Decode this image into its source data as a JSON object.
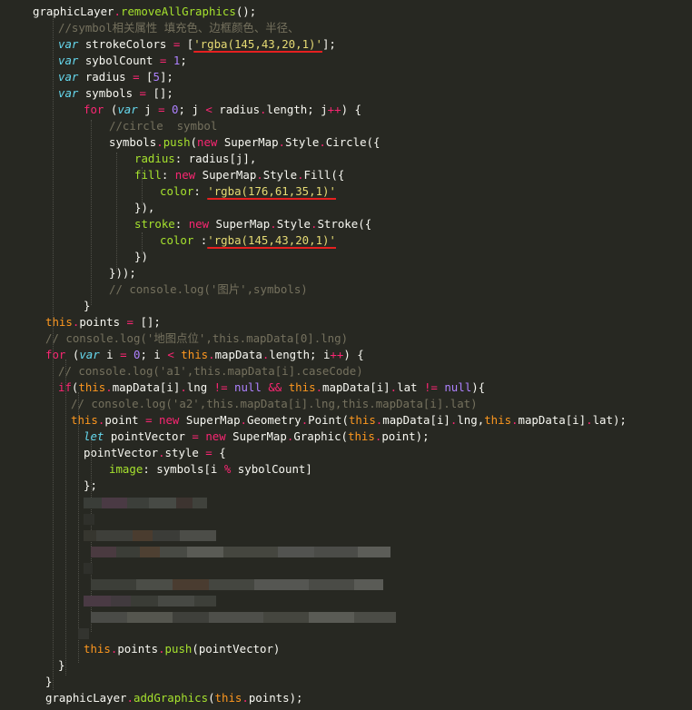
{
  "editor": {
    "theme": "monokai",
    "colors": {
      "background": "#272822",
      "plain": "#f8f8f2",
      "keyword": "#f92672",
      "string": "#e6db74",
      "number": "#ae81ff",
      "function": "#a6e22e",
      "storage": "#66d9ef",
      "comment": "#75715e",
      "builtin": "#fd971f",
      "underline": "#e62020"
    },
    "lines": [
      {
        "tokens": [
          [
            "graphicLayer",
            "pl"
          ],
          [
            ".",
            "kw"
          ],
          [
            "removeAllGraphics",
            "fn"
          ],
          [
            "();",
            "pl"
          ]
        ]
      },
      {
        "tokens": [
          [
            "//symbol相关属性 填充色、边框颜色、半径、",
            "cm"
          ]
        ]
      },
      {
        "tokens": [
          [
            "var",
            "it"
          ],
          [
            " strokeColors ",
            "pl"
          ],
          [
            "=",
            "kw"
          ],
          [
            " [",
            "pl"
          ],
          [
            "'rgba(145,43,20,1)'",
            "st-ul"
          ],
          [
            "];",
            "pl"
          ]
        ]
      },
      {
        "tokens": [
          [
            "var",
            "it"
          ],
          [
            " sybolCount ",
            "pl"
          ],
          [
            "=",
            "kw"
          ],
          [
            " ",
            "pl"
          ],
          [
            "1",
            "nu"
          ],
          [
            ";",
            "pl"
          ]
        ]
      },
      {
        "tokens": [
          [
            "var",
            "it"
          ],
          [
            " radius ",
            "pl"
          ],
          [
            "=",
            "kw"
          ],
          [
            " [",
            "pl"
          ],
          [
            "5",
            "nu"
          ],
          [
            "];",
            "pl"
          ]
        ]
      },
      {
        "tokens": [
          [
            "var",
            "it"
          ],
          [
            " symbols ",
            "pl"
          ],
          [
            "=",
            "kw"
          ],
          [
            " [];",
            "pl"
          ]
        ]
      },
      {
        "tokens": [
          [
            "for",
            "kw"
          ],
          [
            " (",
            "pl"
          ],
          [
            "var",
            "it"
          ],
          [
            " j ",
            "pl"
          ],
          [
            "=",
            "kw"
          ],
          [
            " ",
            "pl"
          ],
          [
            "0",
            "nu"
          ],
          [
            "; j ",
            "pl"
          ],
          [
            "<",
            "kw"
          ],
          [
            " radius",
            "pl"
          ],
          [
            ".",
            "kw"
          ],
          [
            "length; j",
            "pl"
          ],
          [
            "++",
            "kw"
          ],
          [
            ") {",
            "pl"
          ]
        ]
      },
      {
        "tokens": [
          [
            "//circle  symbol",
            "cm"
          ]
        ]
      },
      {
        "tokens": [
          [
            "symbols",
            "pl"
          ],
          [
            ".",
            "kw"
          ],
          [
            "push",
            "fn"
          ],
          [
            "(",
            "pl"
          ],
          [
            "new",
            "kw"
          ],
          [
            " SuperMap",
            "pl"
          ],
          [
            ".",
            "kw"
          ],
          [
            "Style",
            "pl"
          ],
          [
            ".",
            "kw"
          ],
          [
            "Circle",
            "pl"
          ],
          [
            "({",
            "pl"
          ]
        ]
      },
      {
        "tokens": [
          [
            "radius",
            "fn"
          ],
          [
            ": radius[j],",
            "pl"
          ]
        ]
      },
      {
        "tokens": [
          [
            "fill",
            "fn"
          ],
          [
            ": ",
            "pl"
          ],
          [
            "new",
            "kw"
          ],
          [
            " SuperMap",
            "pl"
          ],
          [
            ".",
            "kw"
          ],
          [
            "Style",
            "pl"
          ],
          [
            ".",
            "kw"
          ],
          [
            "Fill",
            "pl"
          ],
          [
            "({",
            "pl"
          ]
        ]
      },
      {
        "tokens": [
          [
            "color",
            "fn"
          ],
          [
            ": ",
            "pl"
          ],
          [
            "'rgba(176,61,35,1)'",
            "st-ul"
          ]
        ]
      },
      {
        "tokens": [
          [
            "}),",
            "pl"
          ]
        ]
      },
      {
        "tokens": [
          [
            "stroke",
            "fn"
          ],
          [
            ": ",
            "pl"
          ],
          [
            "new",
            "kw"
          ],
          [
            " SuperMap",
            "pl"
          ],
          [
            ".",
            "kw"
          ],
          [
            "Style",
            "pl"
          ],
          [
            ".",
            "kw"
          ],
          [
            "Stroke",
            "pl"
          ],
          [
            "({",
            "pl"
          ]
        ]
      },
      {
        "tokens": [
          [
            "color ",
            "fn"
          ],
          [
            ":",
            "pl"
          ],
          [
            "'rgba(145,43,20,1)'",
            "st-ul"
          ]
        ]
      },
      {
        "tokens": [
          [
            "})",
            "pl"
          ]
        ]
      },
      {
        "tokens": [
          [
            "}));",
            "pl"
          ]
        ]
      },
      {
        "tokens": [
          [
            "// console.log('图片',symbols)",
            "cm"
          ]
        ]
      },
      {
        "tokens": [
          [
            "}",
            "pl"
          ]
        ]
      },
      {
        "tokens": [
          [
            "this",
            "bi"
          ],
          [
            ".",
            "kw"
          ],
          [
            "points ",
            "pl"
          ],
          [
            "=",
            "kw"
          ],
          [
            " [];",
            "pl"
          ]
        ]
      },
      {
        "tokens": [
          [
            "// console.log('地图点位',this.mapData[0].lng)",
            "cm"
          ]
        ]
      },
      {
        "tokens": [
          [
            "for",
            "kw"
          ],
          [
            " (",
            "pl"
          ],
          [
            "var",
            "it"
          ],
          [
            " i ",
            "pl"
          ],
          [
            "=",
            "kw"
          ],
          [
            " ",
            "pl"
          ],
          [
            "0",
            "nu"
          ],
          [
            "; i ",
            "pl"
          ],
          [
            "<",
            "kw"
          ],
          [
            " ",
            "pl"
          ],
          [
            "this",
            "bi"
          ],
          [
            ".",
            "kw"
          ],
          [
            "mapData",
            "pl"
          ],
          [
            ".",
            "kw"
          ],
          [
            "length; i",
            "pl"
          ],
          [
            "++",
            "kw"
          ],
          [
            ") {",
            "pl"
          ]
        ]
      },
      {
        "tokens": [
          [
            "// console.log('a1',this.mapData[i].caseCode)",
            "cm"
          ]
        ]
      },
      {
        "tokens": [
          [
            "if",
            "kw"
          ],
          [
            "(",
            "pl"
          ],
          [
            "this",
            "bi"
          ],
          [
            ".",
            "kw"
          ],
          [
            "mapData[i]",
            "pl"
          ],
          [
            ".",
            "kw"
          ],
          [
            "lng ",
            "pl"
          ],
          [
            "!=",
            "kw"
          ],
          [
            " ",
            "pl"
          ],
          [
            "null",
            "nu"
          ],
          [
            " ",
            "pl"
          ],
          [
            "&&",
            "kw"
          ],
          [
            " ",
            "pl"
          ],
          [
            "this",
            "bi"
          ],
          [
            ".",
            "kw"
          ],
          [
            "mapData[i]",
            "pl"
          ],
          [
            ".",
            "kw"
          ],
          [
            "lat ",
            "pl"
          ],
          [
            "!=",
            "kw"
          ],
          [
            " ",
            "pl"
          ],
          [
            "null",
            "nu"
          ],
          [
            "){",
            "pl"
          ]
        ]
      },
      {
        "tokens": [
          [
            "// console.log('a2',this.mapData[i].lng,this.mapData[i].lat)",
            "cm"
          ]
        ]
      },
      {
        "tokens": [
          [
            "this",
            "bi"
          ],
          [
            ".",
            "kw"
          ],
          [
            "point ",
            "pl"
          ],
          [
            "=",
            "kw"
          ],
          [
            " ",
            "pl"
          ],
          [
            "new",
            "kw"
          ],
          [
            " SuperMap",
            "pl"
          ],
          [
            ".",
            "kw"
          ],
          [
            "Geometry",
            "pl"
          ],
          [
            ".",
            "kw"
          ],
          [
            "Point",
            "pl"
          ],
          [
            "(",
            "pl"
          ],
          [
            "this",
            "bi"
          ],
          [
            ".",
            "kw"
          ],
          [
            "mapData[i]",
            "pl"
          ],
          [
            ".",
            "kw"
          ],
          [
            "lng,",
            "pl"
          ],
          [
            "this",
            "bi"
          ],
          [
            ".",
            "kw"
          ],
          [
            "mapData[i]",
            "pl"
          ],
          [
            ".",
            "kw"
          ],
          [
            "lat);",
            "pl"
          ]
        ]
      },
      {
        "tokens": [
          [
            "let",
            "it"
          ],
          [
            " pointVector ",
            "pl"
          ],
          [
            "=",
            "kw"
          ],
          [
            " ",
            "pl"
          ],
          [
            "new",
            "kw"
          ],
          [
            " SuperMap",
            "pl"
          ],
          [
            ".",
            "kw"
          ],
          [
            "Graphic",
            "pl"
          ],
          [
            "(",
            "pl"
          ],
          [
            "this",
            "bi"
          ],
          [
            ".",
            "kw"
          ],
          [
            "point);",
            "pl"
          ]
        ]
      },
      {
        "tokens": [
          [
            "pointVector",
            "pl"
          ],
          [
            ".",
            "kw"
          ],
          [
            "style ",
            "pl"
          ],
          [
            "=",
            "kw"
          ],
          [
            " {",
            "pl"
          ]
        ]
      },
      {
        "tokens": [
          [
            "image",
            "fn"
          ],
          [
            ": symbols[i ",
            "pl"
          ],
          [
            "%",
            "kw"
          ],
          [
            " sybolCount]",
            "pl"
          ]
        ]
      },
      {
        "tokens": [
          [
            "};",
            "pl"
          ]
        ]
      },
      {
        "tokens": [
          [
            "this",
            "bi"
          ],
          [
            ".",
            "kw"
          ],
          [
            "points",
            "pl"
          ],
          [
            ".",
            "kw"
          ],
          [
            "push",
            "fn"
          ],
          [
            "(pointVector)",
            "pl"
          ]
        ]
      },
      {
        "tokens": [
          [
            "}",
            "pl"
          ]
        ]
      },
      {
        "tokens": [
          [
            "}",
            "pl"
          ]
        ]
      },
      {
        "tokens": [
          [
            "graphicLayer",
            "pl"
          ],
          [
            ".",
            "kw"
          ],
          [
            "addGraphics",
            "fn"
          ],
          [
            "(",
            "pl"
          ],
          [
            "this",
            "bi"
          ],
          [
            ".",
            "kw"
          ],
          [
            "points);",
            "pl"
          ]
        ]
      }
    ]
  }
}
